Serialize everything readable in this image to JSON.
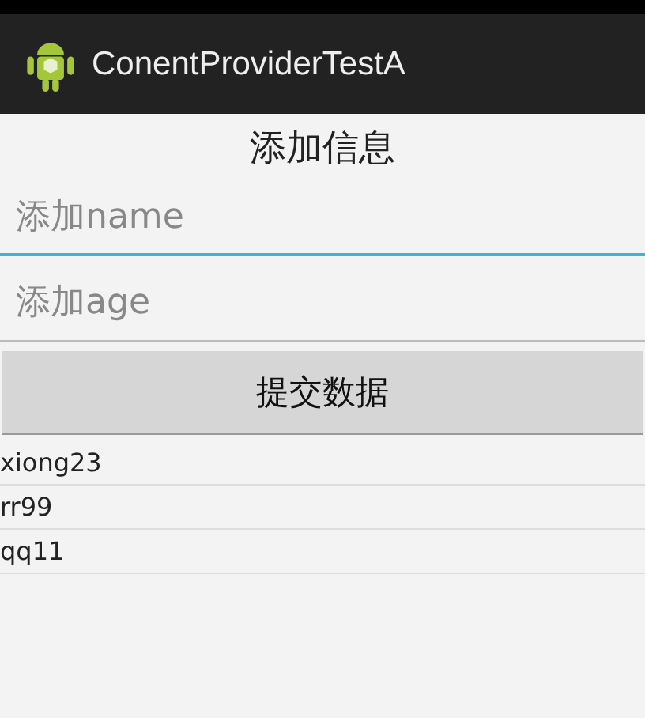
{
  "app_bar": {
    "title": "ConentProviderTestA"
  },
  "heading": "添加信息",
  "fields": [
    {
      "placeholder": "添加name",
      "focused": true
    },
    {
      "placeholder": "添加age",
      "focused": false
    }
  ],
  "submit_button": "提交数据",
  "list": [
    "xiong23",
    "rr99",
    "qq11"
  ]
}
